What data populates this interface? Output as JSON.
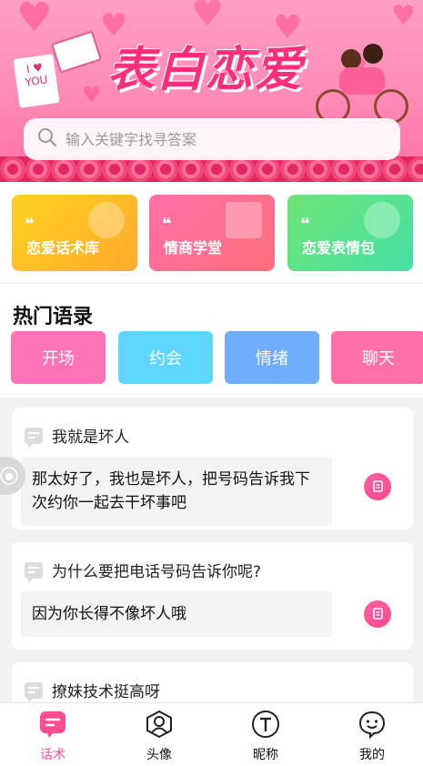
{
  "banner": {
    "title": "表白恋爱",
    "card_text": "I ♥ YOU"
  },
  "search": {
    "placeholder": "输入关键字找寻答案"
  },
  "categories": [
    {
      "label": "恋爱话术库",
      "color_from": "#ffd21f",
      "color_to": "#ffaa2c"
    },
    {
      "label": "情商学堂",
      "color_from": "#ff6fa7",
      "color_to": "#ff6f7c"
    },
    {
      "label": "恋爱表情包",
      "color_from": "#6de575",
      "color_to": "#46e0a6"
    }
  ],
  "hot": {
    "title": "热门语录",
    "tags": [
      "开场",
      "约会",
      "情绪",
      "聊天"
    ]
  },
  "qa": [
    {
      "question": "我就是坏人",
      "answer": "那太好了，我也是坏人，把号码告诉我下次约你一起去干坏事吧"
    },
    {
      "question": "为什么要把电话号码告诉你呢?",
      "answer": "因为你长得不像坏人哦"
    },
    {
      "question": "撩妹技术挺高呀",
      "answer": ""
    }
  ],
  "tabbar": {
    "items": [
      {
        "label": "话术",
        "icon": "chat-icon",
        "active": true
      },
      {
        "label": "头像",
        "icon": "avatar-icon",
        "active": false
      },
      {
        "label": "昵称",
        "icon": "t-letter-icon",
        "active": false
      },
      {
        "label": "我的",
        "icon": "profile-icon",
        "active": false
      }
    ]
  },
  "colors": {
    "accent": "#ff4c95"
  }
}
